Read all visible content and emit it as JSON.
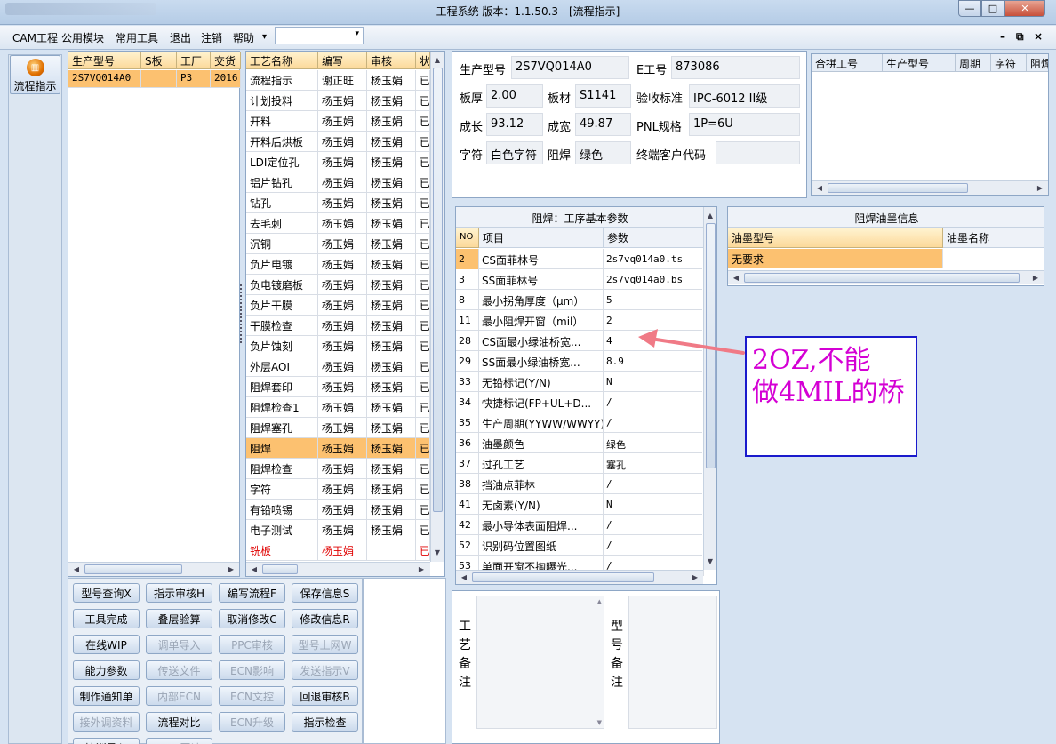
{
  "window": {
    "title": "工程系统   版本：1.1.50.3 - [流程指示]",
    "min": "—",
    "max": "□",
    "close": "✕"
  },
  "menu": {
    "items": [
      "CAM工程",
      "公用模块",
      "常用工具",
      "退出",
      "注销",
      "帮助"
    ],
    "help_arrow": "▾",
    "combo_value": "",
    "combo_arrow": "▾",
    "mdi": [
      "–",
      "⧉",
      "×"
    ]
  },
  "nav": {
    "flow_button": "流程指示"
  },
  "model_grid": {
    "headers": [
      "生产型号",
      "S板",
      "工厂",
      "交货"
    ],
    "rows": [
      [
        "2S7VQ014A0",
        "",
        "P3",
        "2016"
      ]
    ]
  },
  "process_grid": {
    "headers": [
      "工艺名称",
      "编写",
      "审核",
      "状"
    ],
    "rows": [
      [
        "流程指示",
        "谢正旺",
        "杨玉娟",
        "已"
      ],
      [
        "计划投料",
        "杨玉娟",
        "杨玉娟",
        "已"
      ],
      [
        "开料",
        "杨玉娟",
        "杨玉娟",
        "已"
      ],
      [
        "开料后烘板",
        "杨玉娟",
        "杨玉娟",
        "已"
      ],
      [
        "LDI定位孔",
        "杨玉娟",
        "杨玉娟",
        "已"
      ],
      [
        "铝片钻孔",
        "杨玉娟",
        "杨玉娟",
        "已"
      ],
      [
        "钻孔",
        "杨玉娟",
        "杨玉娟",
        "已"
      ],
      [
        "去毛刺",
        "杨玉娟",
        "杨玉娟",
        "已"
      ],
      [
        "沉铜",
        "杨玉娟",
        "杨玉娟",
        "已"
      ],
      [
        "负片电镀",
        "杨玉娟",
        "杨玉娟",
        "已"
      ],
      [
        "负电镀磨板",
        "杨玉娟",
        "杨玉娟",
        "已"
      ],
      [
        "负片干膜",
        "杨玉娟",
        "杨玉娟",
        "已"
      ],
      [
        "干膜检查",
        "杨玉娟",
        "杨玉娟",
        "已"
      ],
      [
        "负片蚀刻",
        "杨玉娟",
        "杨玉娟",
        "已"
      ],
      [
        "外层AOI",
        "杨玉娟",
        "杨玉娟",
        "已"
      ],
      [
        "阻焊套印",
        "杨玉娟",
        "杨玉娟",
        "已"
      ],
      [
        "阻焊检查1",
        "杨玉娟",
        "杨玉娟",
        "已"
      ],
      [
        "阻焊塞孔",
        "杨玉娟",
        "杨玉娟",
        "已"
      ],
      [
        "阻焊",
        "杨玉娟",
        "杨玉娟",
        "已"
      ],
      [
        "阻焊检查",
        "杨玉娟",
        "杨玉娟",
        "已"
      ],
      [
        "字符",
        "杨玉娟",
        "杨玉娟",
        "已"
      ],
      [
        "有铅喷锡",
        "杨玉娟",
        "杨玉娟",
        "已"
      ],
      [
        "电子测试",
        "杨玉娟",
        "杨玉娟",
        "已"
      ],
      [
        "铣板",
        "杨玉娟",
        "",
        "已"
      ]
    ],
    "selected_index": 18,
    "red_index": 23
  },
  "buttons": [
    [
      "型号查询X",
      "指示审核H",
      "编写流程F",
      "保存信息S"
    ],
    [
      "工具完成",
      "叠层验算",
      "取消修改C",
      "修改信息R"
    ],
    [
      "在线WIP",
      "调单导入",
      "PPC审核",
      "型号上网W"
    ],
    [
      "能力参数",
      "传送文件",
      "ECN影响",
      "发送指示V"
    ],
    [
      "制作通知单",
      "内部ECN",
      "ECN文控",
      "回退审核B"
    ],
    [
      "接外调资料",
      "流程对比",
      "ECN升级",
      "指示检查"
    ],
    [
      "培训导入",
      "MRP回读",
      "",
      ""
    ]
  ],
  "buttons_disabled": [
    [
      false,
      false,
      false,
      false
    ],
    [
      false,
      false,
      false,
      false
    ],
    [
      false,
      true,
      true,
      true
    ],
    [
      false,
      true,
      true,
      true
    ],
    [
      false,
      true,
      true,
      false
    ],
    [
      true,
      false,
      true,
      false
    ],
    [
      false,
      true,
      false,
      false
    ]
  ],
  "info": {
    "prod_model_label": "生产型号",
    "prod_model": "2S7VQ014A0",
    "e_no_label": "E工号",
    "e_no": "873086",
    "thickness_label": "板厚",
    "thickness": "2.00",
    "material_label": "板材",
    "material": "S1141",
    "standard_label": "验收标准",
    "standard": "IPC-6012 II级",
    "length_label": "成长",
    "length": "93.12",
    "width_label": "成宽",
    "width": "49.87",
    "pnl_label": "PNL规格",
    "pnl": "1P=6U",
    "char_label": "字符",
    "char": "白色字符",
    "mask_label": "阻焊",
    "mask": "绿色",
    "customer_label": "终端客户代码",
    "customer": ""
  },
  "merge_grid": {
    "headers": [
      "合拼工号",
      "生产型号",
      "周期",
      "字符",
      "阻焊"
    ]
  },
  "param_grid": {
    "title": "阻焊：工序基本参数",
    "headers": [
      "NO",
      "项目",
      "参数"
    ],
    "rows": [
      [
        "2",
        "CS面菲林号",
        "2s7vq014a0.ts"
      ],
      [
        "3",
        "SS面菲林号",
        "2s7vq014a0.bs"
      ],
      [
        "8",
        "最小拐角厚度（μm）",
        "5"
      ],
      [
        "11",
        "最小阻焊开窗（mil）",
        "2"
      ],
      [
        "28",
        "CS面最小绿油桥宽...",
        "4"
      ],
      [
        "29",
        "SS面最小绿油桥宽...",
        "8.9"
      ],
      [
        "33",
        "无铅标记(Y/N)",
        "N"
      ],
      [
        "34",
        "快捷标记(FP+UL+D...",
        "/"
      ],
      [
        "35",
        "生产周期(YYWW/WWYY)",
        "/"
      ],
      [
        "36",
        "油墨颜色",
        "绿色"
      ],
      [
        "37",
        "过孔工艺",
        "塞孔"
      ],
      [
        "38",
        "挡油点菲林",
        "/"
      ],
      [
        "41",
        "无卤素(Y/N)",
        "N"
      ],
      [
        "42",
        "最小导体表面阻焊...",
        "/"
      ],
      [
        "52",
        "识别码位置图纸",
        "/"
      ],
      [
        "53",
        "单面开窗不掏曝光...",
        "/"
      ]
    ],
    "selected_index": 0
  },
  "ink_grid": {
    "title": "阻焊油墨信息",
    "headers": [
      "油墨型号",
      "油墨名称"
    ],
    "rows": [
      [
        "无要求",
        ""
      ]
    ]
  },
  "annotation": {
    "line1": "2OZ,不能",
    "line2": "做4MIL的桥",
    "color": "#d400d4",
    "border": "#1a1acc",
    "arrow_color": "#f07a86"
  },
  "remarks": {
    "process_label": [
      "工",
      "艺",
      "备",
      "注"
    ],
    "model_label": [
      "型",
      "号",
      "备",
      "注"
    ]
  }
}
